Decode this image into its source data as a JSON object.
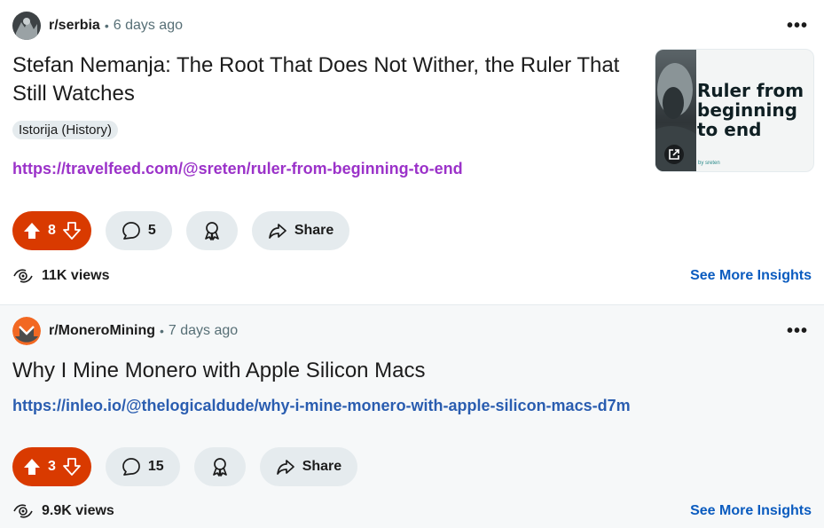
{
  "posts": [
    {
      "subreddit": "r/serbia",
      "age": "6 days ago",
      "more": "•••",
      "title": "Stefan Nemanja: The Root That Does Not Wither, the Ruler That Still Watches",
      "flair": "Istorija (History)",
      "link": "https://travelfeed.com/@sreten/ruler-from-beginning-to-end",
      "thumbnail": {
        "text": "Ruler from beginning to end",
        "byline": "by sreten"
      },
      "votes": "8",
      "comments": "5",
      "share": "Share",
      "views": "11K views",
      "insights": "See More Insights"
    },
    {
      "subreddit": "r/MoneroMining",
      "age": "7 days ago",
      "more": "•••",
      "title": "Why I Mine Monero with Apple Silicon Macs",
      "link": "https://inleo.io/@thelogicaldude/why-i-mine-monero-with-apple-silicon-macs-d7m",
      "votes": "3",
      "comments": "15",
      "share": "Share",
      "views": "9.9K views",
      "insights": "See More Insights"
    }
  ],
  "colors": {
    "upvote_active": "#d93a00",
    "visited_link": "#9b32c9",
    "link": "#2a5db0",
    "insights": "#0a5bbf",
    "pill_bg": "#e5ebee",
    "monero_orange": "#f26822"
  }
}
